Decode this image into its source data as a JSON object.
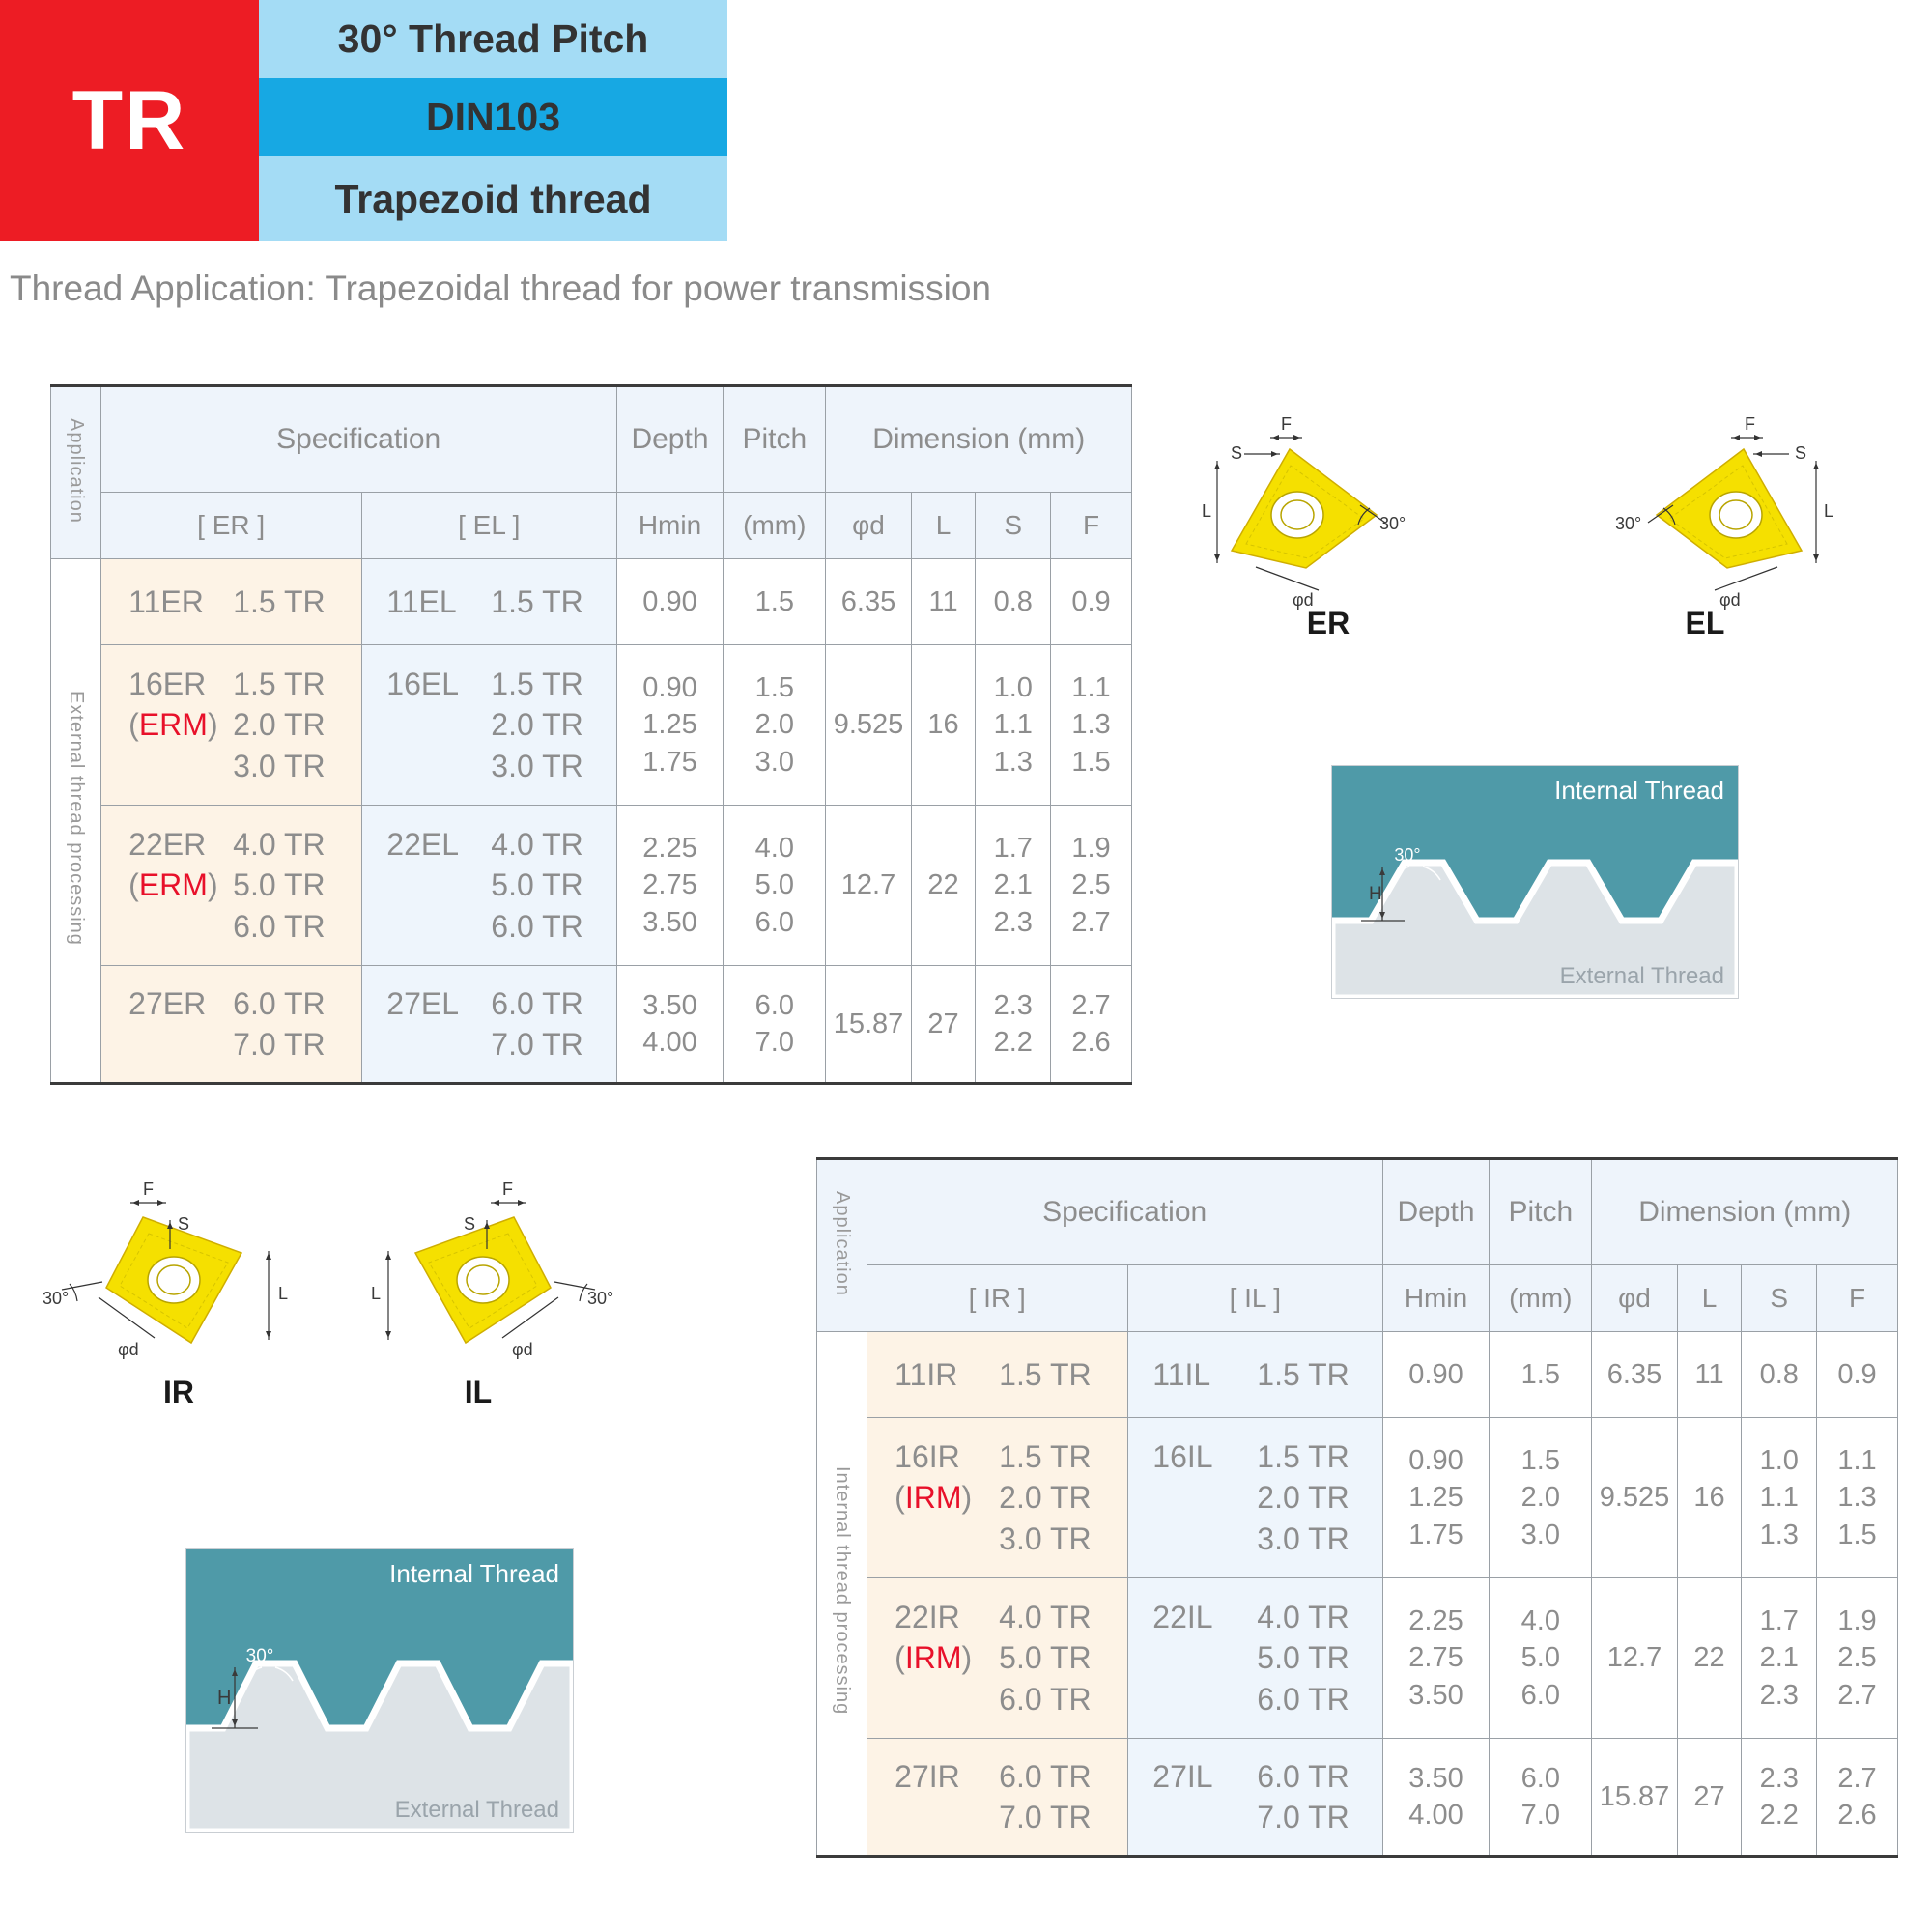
{
  "banner": {
    "code": "TR",
    "lines": [
      "30° Thread Pitch",
      "DIN103",
      "Trapezoid thread"
    ]
  },
  "subtitle": "Thread Application: Trapezoidal thread for power transmission",
  "external_table": {
    "application_label": "Application",
    "application_side": "External thread processing",
    "headers": {
      "specification": "Specification",
      "depth": "Depth",
      "pitch": "Pitch",
      "dimension": "Dimension (mm)"
    },
    "subheaders": {
      "right": "[ ER ]",
      "left": "[ EL ]",
      "hmin": "Hmin",
      "mm": "(mm)",
      "phid": "φd",
      "l": "L",
      "s": "S",
      "f": "F"
    },
    "rows": [
      {
        "er_code": "11ER",
        "er_extra": "",
        "el_code": "11EL",
        "pitches": [
          "1.5 TR"
        ],
        "hmin": [
          "0.90"
        ],
        "mm": [
          "1.5"
        ],
        "phid": "6.35",
        "l": "11",
        "s": [
          "0.8"
        ],
        "f": [
          "0.9"
        ]
      },
      {
        "er_code": "16ER",
        "er_extra": "(ERM)",
        "el_code": "16EL",
        "pitches": [
          "1.5 TR",
          "2.0 TR",
          "3.0 TR"
        ],
        "hmin": [
          "0.90",
          "1.25",
          "1.75"
        ],
        "mm": [
          "1.5",
          "2.0",
          "3.0"
        ],
        "phid": "9.525",
        "l": "16",
        "s": [
          "1.0",
          "1.1",
          "1.3"
        ],
        "f": [
          "1.1",
          "1.3",
          "1.5"
        ]
      },
      {
        "er_code": "22ER",
        "er_extra": "(ERM)",
        "el_code": "22EL",
        "pitches": [
          "4.0 TR",
          "5.0 TR",
          "6.0 TR"
        ],
        "hmin": [
          "2.25",
          "2.75",
          "3.50"
        ],
        "mm": [
          "4.0",
          "5.0",
          "6.0"
        ],
        "phid": "12.7",
        "l": "22",
        "s": [
          "1.7",
          "2.1",
          "2.3"
        ],
        "f": [
          "1.9",
          "2.5",
          "2.7"
        ]
      },
      {
        "er_code": "27ER",
        "er_extra": "",
        "el_code": "27EL",
        "pitches": [
          "6.0 TR",
          "7.0 TR"
        ],
        "hmin": [
          "3.50",
          "4.00"
        ],
        "mm": [
          "6.0",
          "7.0"
        ],
        "phid": "15.87",
        "l": "27",
        "s": [
          "2.3",
          "2.2"
        ],
        "f": [
          "2.7",
          "2.6"
        ]
      }
    ]
  },
  "internal_table": {
    "application_label": "Application",
    "application_side": "Internal thread processing",
    "headers": {
      "specification": "Specification",
      "depth": "Depth",
      "pitch": "Pitch",
      "dimension": "Dimension (mm)"
    },
    "subheaders": {
      "right": "[ IR ]",
      "left": "[ IL ]",
      "hmin": "Hmin",
      "mm": "(mm)",
      "phid": "φd",
      "l": "L",
      "s": "S",
      "f": "F"
    },
    "rows": [
      {
        "er_code": "11IR",
        "er_extra": "",
        "el_code": "11IL",
        "pitches": [
          "1.5 TR"
        ],
        "hmin": [
          "0.90"
        ],
        "mm": [
          "1.5"
        ],
        "phid": "6.35",
        "l": "11",
        "s": [
          "0.8"
        ],
        "f": [
          "0.9"
        ]
      },
      {
        "er_code": "16IR",
        "er_extra": "(IRM)",
        "el_code": "16IL",
        "pitches": [
          "1.5 TR",
          "2.0 TR",
          "3.0 TR"
        ],
        "hmin": [
          "0.90",
          "1.25",
          "1.75"
        ],
        "mm": [
          "1.5",
          "2.0",
          "3.0"
        ],
        "phid": "9.525",
        "l": "16",
        "s": [
          "1.0",
          "1.1",
          "1.3"
        ],
        "f": [
          "1.1",
          "1.3",
          "1.5"
        ]
      },
      {
        "er_code": "22IR",
        "er_extra": "(IRM)",
        "el_code": "22IL",
        "pitches": [
          "4.0 TR",
          "5.0 TR",
          "6.0 TR"
        ],
        "hmin": [
          "2.25",
          "2.75",
          "3.50"
        ],
        "mm": [
          "4.0",
          "5.0",
          "6.0"
        ],
        "phid": "12.7",
        "l": "22",
        "s": [
          "1.7",
          "2.1",
          "2.3"
        ],
        "f": [
          "1.9",
          "2.5",
          "2.7"
        ]
      },
      {
        "er_code": "27IR",
        "er_extra": "",
        "el_code": "27IL",
        "pitches": [
          "6.0 TR",
          "7.0 TR"
        ],
        "hmin": [
          "3.50",
          "4.00"
        ],
        "mm": [
          "6.0",
          "7.0"
        ],
        "phid": "15.87",
        "l": "27",
        "s": [
          "2.3",
          "2.2"
        ],
        "f": [
          "2.7",
          "2.6"
        ]
      }
    ]
  },
  "figures": {
    "er": {
      "caption": "ER",
      "angle": "30°",
      "dims": [
        "F",
        "S",
        "L",
        "φd"
      ]
    },
    "el": {
      "caption": "EL",
      "angle": "30°",
      "dims": [
        "F",
        "S",
        "L",
        "φd"
      ]
    },
    "ir": {
      "caption": "IR",
      "angle": "30°",
      "dims": [
        "F",
        "S",
        "L",
        "φd"
      ]
    },
    "il": {
      "caption": "IL",
      "angle": "30°",
      "dims": [
        "F",
        "S",
        "L",
        "φd"
      ]
    }
  },
  "thread_profiles": {
    "top": {
      "internal_label": "Internal Thread",
      "external_label": "External Thread",
      "angle": "30°",
      "height_label": "H"
    },
    "bottom": {
      "internal_label": "Internal Thread",
      "external_label": "External Thread",
      "angle": "30°",
      "height_label": "H"
    }
  },
  "colors": {
    "brand_red": "#ed1c24",
    "banner_light": "#a4dcf5",
    "banner_dark": "#17a8e3",
    "insert_yellow": "#f5e000",
    "thread_teal": "#4f9aa8",
    "erm_red": "#e8102a"
  }
}
